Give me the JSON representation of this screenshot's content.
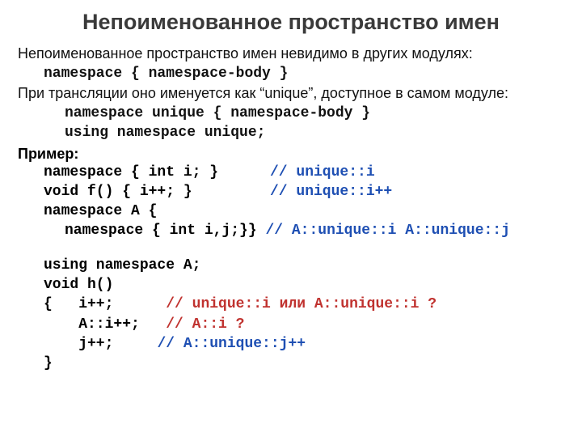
{
  "title": "Непоименованное пространство имен",
  "p1": "Непоименованное пространство имен невидимо в других модулях:",
  "c1": "namespace { namespace-body }",
  "p2": "При трансляции оно именуется как “unique”, доступное в самом модуле:",
  "c2": "namespace unique { namespace-body }",
  "c3": "using namespace unique;",
  "example_label": "Пример:",
  "ex": {
    "r1code": "namespace { int i; }",
    "r1cmt": "// unique::i",
    "r2code": "void f() { i++; }",
    "r2cmt": "// unique::i++",
    "r3code": "namespace A {",
    "r4code": "namespace { int i,j;}} ",
    "r4cmt": "// A::unique::i A::unique::j",
    "r5code": "using namespace A;",
    "r6code": "void h()",
    "r7code": "{   i++;      ",
    "r7cmt": "// unique::i или A::unique::i ?",
    "r8code": "    A::i++;   ",
    "r8cmt": "// A::i ?",
    "r9code": "    j++;     ",
    "r9cmt": "// A::unique::j++",
    "r10code": "}"
  }
}
